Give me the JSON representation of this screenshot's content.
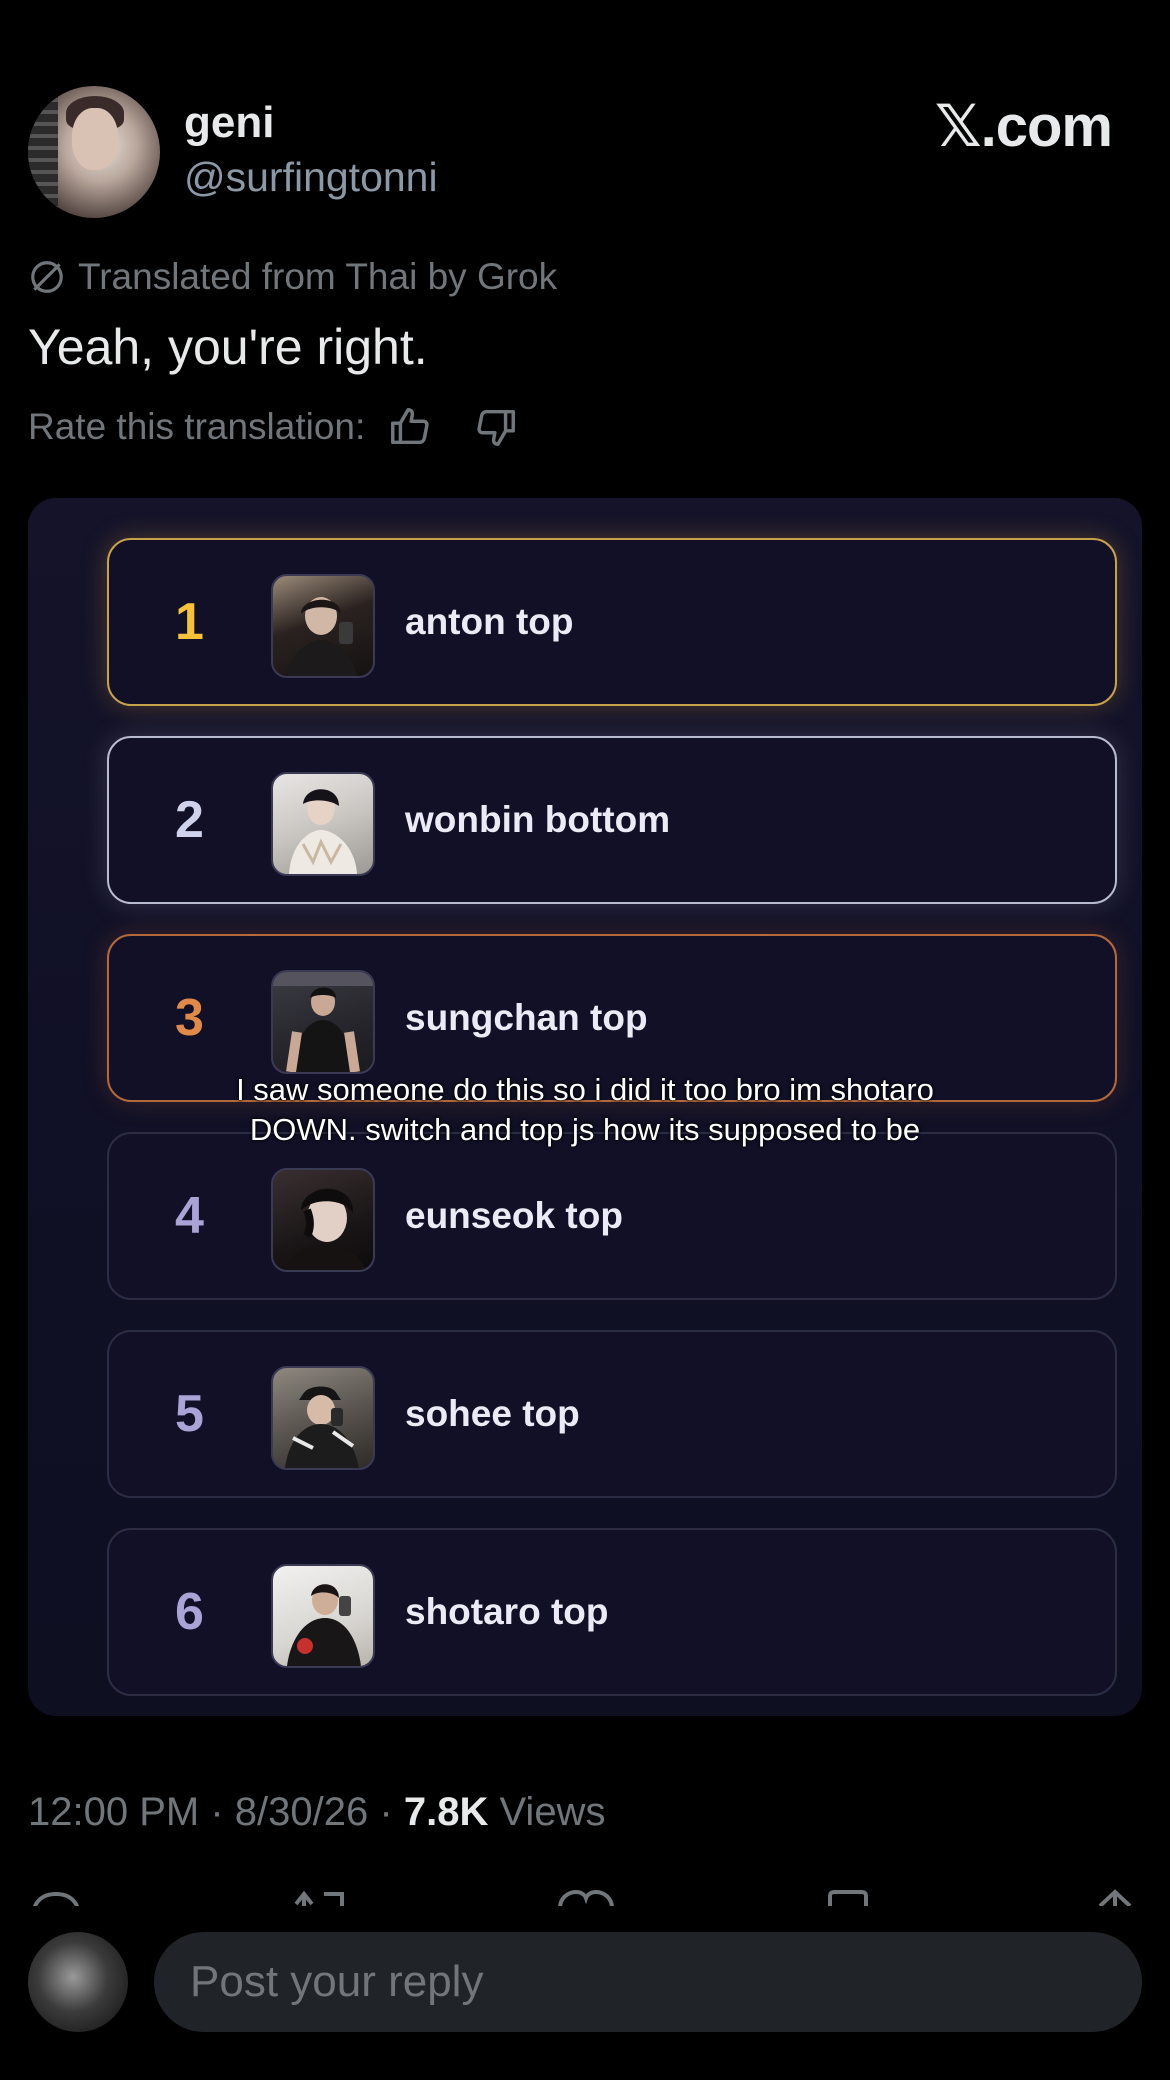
{
  "post": {
    "display_name": "geni",
    "handle": "@surfingtonni",
    "brand": "𝕏.com",
    "translation_note": "Translated from Thai by Grok",
    "text": "Yeah, you're right.",
    "rate_label": "Rate this translation:",
    "time": "12:00 PM",
    "date": "8/30/26",
    "views_count": "7.8K",
    "views_label": "Views",
    "separator": "·"
  },
  "ranking": {
    "items": [
      {
        "rank": "1",
        "label": "anton top",
        "color": "#f5c23a"
      },
      {
        "rank": "2",
        "label": "wonbin bottom",
        "color": "#cfd2ea"
      },
      {
        "rank": "3",
        "label": "sungchan top",
        "color": "#e08a4a"
      },
      {
        "rank": "4",
        "label": "eunseok top",
        "color": "#a9a3d6"
      },
      {
        "rank": "5",
        "label": "sohee top",
        "color": "#a9a3d6"
      },
      {
        "rank": "6",
        "label": "shotaro top",
        "color": "#a9a3d6"
      }
    ],
    "caption_line1": "I saw someone do this so i did it too bro im shotaro",
    "caption_line2": "DOWN. switch and top js how its supposed to be"
  },
  "reply": {
    "placeholder": "Post your reply"
  },
  "icons": {
    "grok": "grok-slash-icon",
    "like_translation": "thumbs-up-icon",
    "dislike_translation": "thumbs-down-icon"
  }
}
